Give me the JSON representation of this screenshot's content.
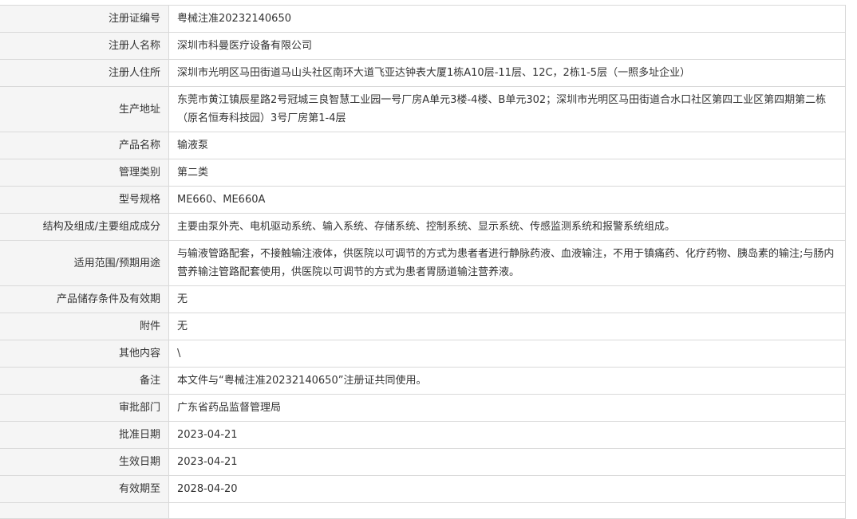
{
  "rows": [
    {
      "label": "注册证编号",
      "value": "粤械注准20232140650"
    },
    {
      "label": "注册人名称",
      "value": "深圳市科曼医疗设备有限公司"
    },
    {
      "label": "注册人住所",
      "value": "深圳市光明区马田街道马山头社区南环大道飞亚达钟表大厦1栋A10层-11层、12C，2栋1-5层（一照多址企业）"
    },
    {
      "label": "生产地址",
      "value": "东莞市黄江镇辰星路2号冠城三良智慧工业园一号厂房A单元3楼-4楼、B单元302；深圳市光明区马田街道合水口社区第四工业区第四期第二栋（原名恒寿科技园）3号厂房第1-4层"
    },
    {
      "label": "产品名称",
      "value": "输液泵"
    },
    {
      "label": "管理类别",
      "value": "第二类"
    },
    {
      "label": "型号规格",
      "value": "ME660、ME660A"
    },
    {
      "label": "结构及组成/主要组成成分",
      "value": "主要由泵外壳、电机驱动系统、输入系统、存储系统、控制系统、显示系统、传感监测系统和报警系统组成。"
    },
    {
      "label": "适用范围/预期用途",
      "value": "与输液管路配套，不接触输注液体，供医院以可调节的方式为患者者进行静脉药液、血液输注，不用于镇痛药、化疗药物、胰岛素的输注;与肠内营养输注管路配套使用，供医院以可调节的方式为患者胃肠道输注营养液。"
    },
    {
      "label": "产品储存条件及有效期",
      "value": "无"
    },
    {
      "label": "附件",
      "value": "无"
    },
    {
      "label": "其他内容",
      "value": "\\"
    },
    {
      "label": "备注",
      "value": "本文件与“粤械注准20232140650”注册证共同使用。"
    },
    {
      "label": "审批部门",
      "value": "广东省药品监督管理局"
    },
    {
      "label": "批准日期",
      "value": "2023-04-21"
    },
    {
      "label": "生效日期",
      "value": "2023-04-21"
    },
    {
      "label": "有效期至",
      "value": "2028-04-20"
    },
    {
      "label": "",
      "value": ""
    }
  ]
}
